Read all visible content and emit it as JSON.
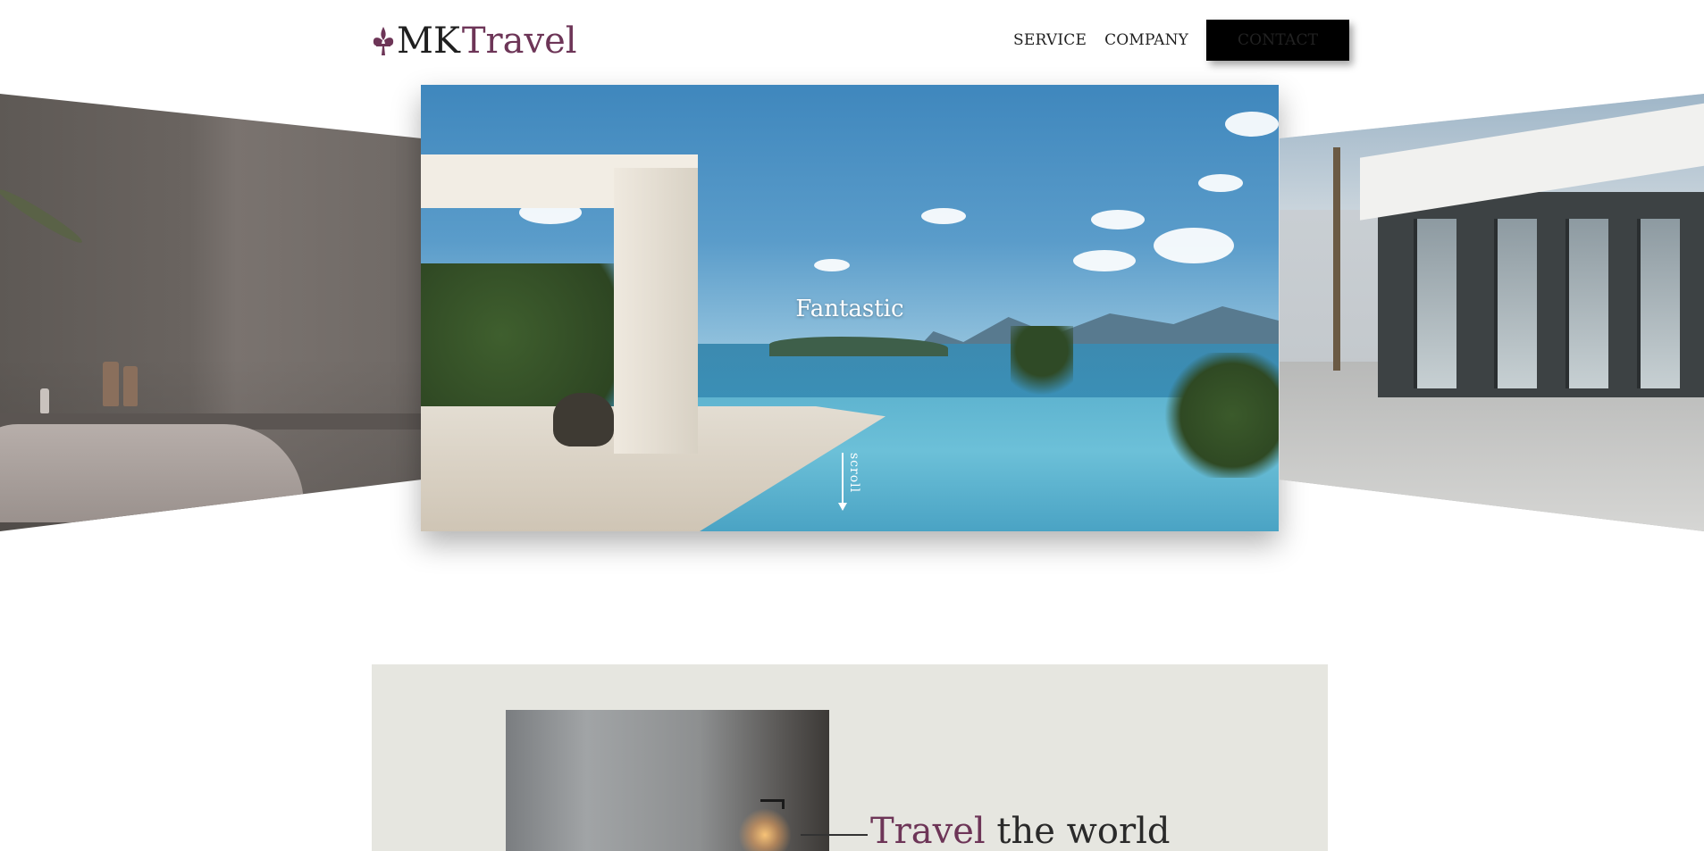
{
  "brand": {
    "logo_part1": "MK",
    "logo_part2": "Travel",
    "logo_icon": "fleur-de-lis-icon",
    "accent_color": "#6d3557"
  },
  "nav": {
    "items": [
      {
        "label": "SERVICE"
      },
      {
        "label": "COMPANY"
      }
    ],
    "contact_label": "CONTACT"
  },
  "carousel": {
    "active_slide_title": "Fantastic",
    "scroll_label": "scroll"
  },
  "intro": {
    "heading_accent": "Travel",
    "heading_rest": " the world"
  }
}
